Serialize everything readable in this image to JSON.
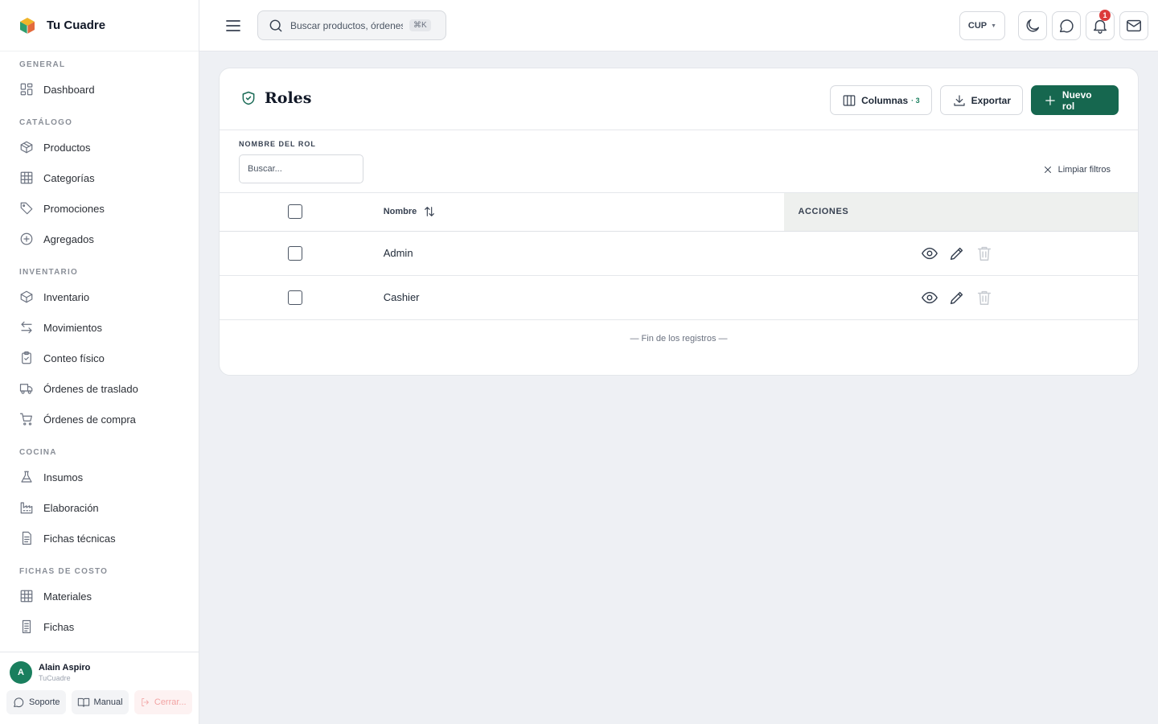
{
  "brand": {
    "name": "Tu Cuadre"
  },
  "sidebar": {
    "sections": [
      {
        "title": "GENERAL",
        "items": [
          {
            "label": "Dashboard",
            "icon": "grid-icon"
          }
        ]
      },
      {
        "title": "CATÁLOGO",
        "items": [
          {
            "label": "Productos",
            "icon": "box-icon"
          },
          {
            "label": "Categorías",
            "icon": "table-icon"
          },
          {
            "label": "Promociones",
            "icon": "tag-icon"
          },
          {
            "label": "Agregados",
            "icon": "plus-circle-icon"
          }
        ]
      },
      {
        "title": "INVENTARIO",
        "items": [
          {
            "label": "Inventario",
            "icon": "box-icon"
          },
          {
            "label": "Movimientos",
            "icon": "arrows-icon"
          },
          {
            "label": "Conteo físico",
            "icon": "clipboard-check-icon"
          },
          {
            "label": "Órdenes de traslado",
            "icon": "truck-icon"
          },
          {
            "label": "Órdenes de compra",
            "icon": "cart-icon"
          }
        ]
      },
      {
        "title": "COCINA",
        "items": [
          {
            "label": "Insumos",
            "icon": "flask-icon"
          },
          {
            "label": "Elaboración",
            "icon": "factory-icon"
          },
          {
            "label": "Fichas técnicas",
            "icon": "document-icon"
          }
        ]
      },
      {
        "title": "FICHAS DE COSTO",
        "items": [
          {
            "label": "Materiales",
            "icon": "table-icon"
          },
          {
            "label": "Fichas",
            "icon": "document-icon"
          }
        ]
      }
    ]
  },
  "user": {
    "initial": "A",
    "name": "Alain Aspiro",
    "org": "TuCuadre",
    "support_label": "Soporte",
    "manual_label": "Manual",
    "logout_label": "Cerrar..."
  },
  "topbar": {
    "search_placeholder": "Buscar productos, órdenes",
    "shortcut": "⌘K",
    "currency": "CUP",
    "notifications_count": "1"
  },
  "page": {
    "title": "Roles",
    "columns_label": "Columnas",
    "columns_count": "· 3",
    "export_label": "Exportar",
    "new_label": "Nuevo rol",
    "filter_label": "NOMBRE DEL ROL",
    "filter_placeholder": "Buscar...",
    "clear_filters_label": "Limpiar filtros",
    "table": {
      "name_header": "Nombre",
      "actions_header": "ACCIONES",
      "rows": [
        {
          "name": "Admin"
        },
        {
          "name": "Cashier"
        }
      ]
    },
    "end_text": "— Fin de los registros —"
  },
  "colors": {
    "accent": "#16674f",
    "badge": "#dc3b3b",
    "logout": "#f2a3a3"
  }
}
